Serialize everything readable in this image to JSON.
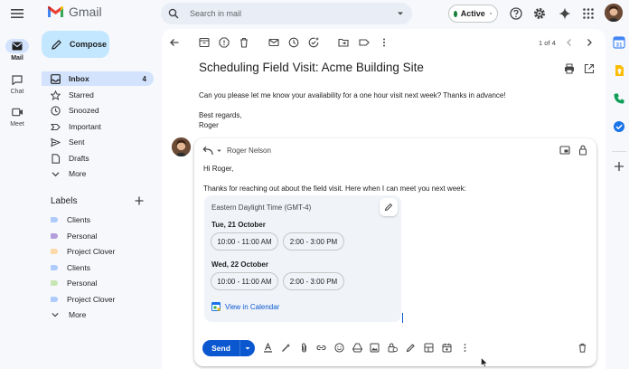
{
  "header": {
    "app_name": "Gmail",
    "search_placeholder": "Search in mail",
    "status": "Active"
  },
  "rail": [
    {
      "label": "Mail",
      "icon": "mail-icon"
    },
    {
      "label": "Chat",
      "icon": "chat-icon"
    },
    {
      "label": "Meet",
      "icon": "meet-icon"
    }
  ],
  "compose_label": "Compose",
  "nav": [
    {
      "label": "Inbox",
      "count": "4",
      "icon": "inbox-icon"
    },
    {
      "label": "Starred",
      "icon": "star-icon"
    },
    {
      "label": "Snoozed",
      "icon": "clock-icon"
    },
    {
      "label": "Important",
      "icon": "important-icon"
    },
    {
      "label": "Sent",
      "icon": "send-icon"
    },
    {
      "label": "Drafts",
      "icon": "draft-icon"
    },
    {
      "label": "More",
      "icon": "chevron-down-icon"
    }
  ],
  "labels": {
    "title": "Labels",
    "items": [
      {
        "label": "Clients",
        "color": "#aecbfa"
      },
      {
        "label": "Personal",
        "color": "#b39ddb"
      },
      {
        "label": "Project Clover",
        "color": "#fdd8a8"
      },
      {
        "label": "Clients",
        "color": "#aecbfa"
      },
      {
        "label": "Personal",
        "color": "#c8e6b4"
      },
      {
        "label": "Project Clover",
        "color": "#aecbfa"
      }
    ],
    "more": "More"
  },
  "toolbar": {
    "pagination": "1 of 4"
  },
  "email": {
    "subject": "Scheduling Field Visit: Acme Building Site",
    "body": "Can you please let me know your availability for a one hour visit next week? Thanks in advance!",
    "closing": "Best regards,",
    "signature": "Roger"
  },
  "reply": {
    "recipient": "Roger Nelson",
    "greeting": "Hi Roger,",
    "text": "Thanks for reaching out about the field visit. Here when I can meet you next week:",
    "timezone": "Eastern Daylight Time (GMT-4)",
    "days": [
      {
        "day": "Tue, 21 October",
        "slots": [
          "10:00 - 11:00 AM",
          "2:00 - 3:00 PM"
        ]
      },
      {
        "day": "Wed, 22 October",
        "slots": [
          "10:00 - 11:00 AM",
          "2:00 - 3:00 PM"
        ]
      }
    ],
    "calendar_link": "View in Calendar",
    "send_label": "Send"
  },
  "colors": {
    "accent": "#0b57d0",
    "compose_bg": "#c2e7ff",
    "active_nav": "#d3e3fd",
    "status_green": "#188038"
  }
}
